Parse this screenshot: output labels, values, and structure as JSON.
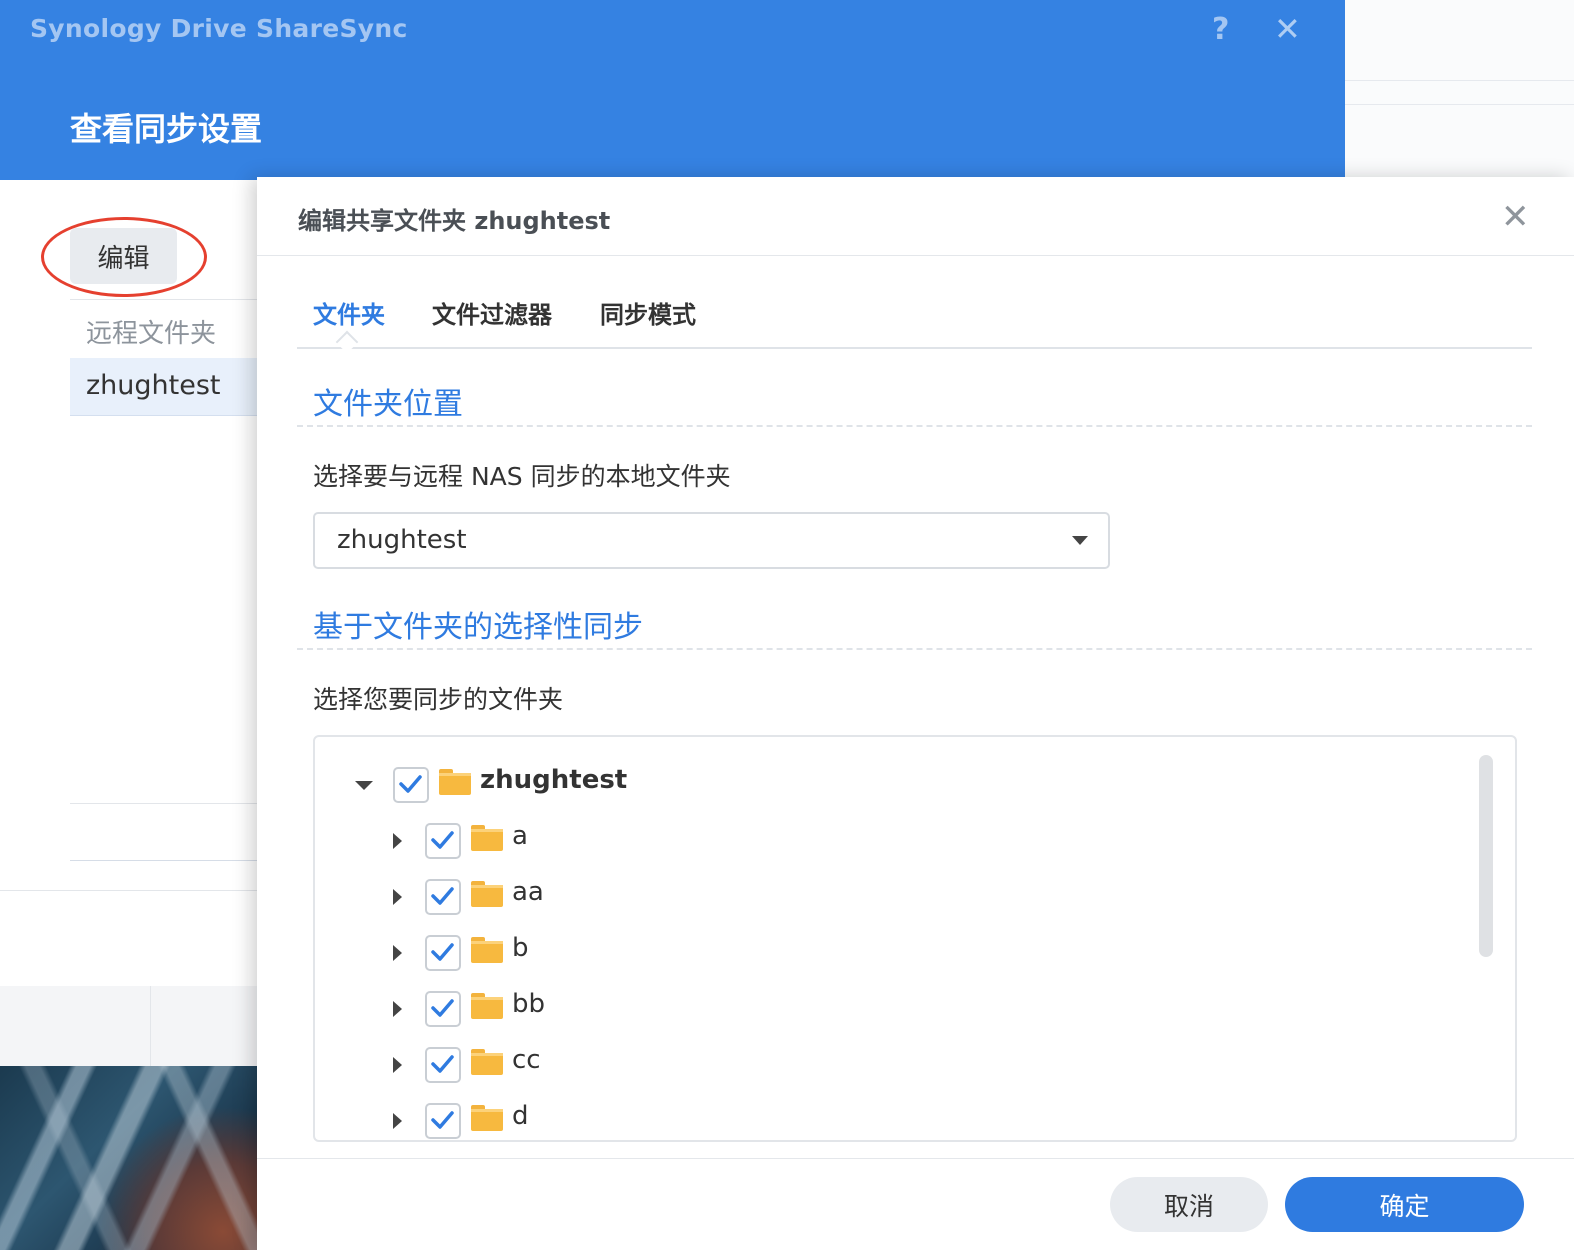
{
  "app": {
    "title": "Synology Drive ShareSync",
    "help_label": "?",
    "close_label": "✕"
  },
  "background_window": {
    "heading": "查看同步设置",
    "edit_label": "编辑",
    "column_header": "远程文件夹",
    "selected_row": "zhughtest"
  },
  "dialog": {
    "title": "编辑共享文件夹 zhughtest",
    "close_label": "✕",
    "tabs": [
      {
        "label": "文件夹",
        "active": true
      },
      {
        "label": "文件过滤器",
        "active": false
      },
      {
        "label": "同步模式",
        "active": false
      }
    ],
    "folder_location": {
      "section_title": "文件夹位置",
      "prompt": "选择要与远程 NAS 同步的本地文件夹",
      "selected_folder": "zhughtest"
    },
    "selective_sync": {
      "section_title": "基于文件夹的选择性同步",
      "prompt": "选择您要同步的文件夹",
      "tree": {
        "root": {
          "label": "zhughtest",
          "checked": true,
          "expanded": true
        },
        "children": [
          {
            "label": "a",
            "checked": true
          },
          {
            "label": "aa",
            "checked": true
          },
          {
            "label": "b",
            "checked": true
          },
          {
            "label": "bb",
            "checked": true
          },
          {
            "label": "cc",
            "checked": true
          },
          {
            "label": "d",
            "checked": true
          }
        ]
      }
    },
    "buttons": {
      "cancel": "取消",
      "ok": "确定"
    }
  },
  "colors": {
    "accent": "#2f7be0",
    "header_blue": "#3582e2",
    "folder": "#f7b93f",
    "highlight": "#e5402f"
  }
}
